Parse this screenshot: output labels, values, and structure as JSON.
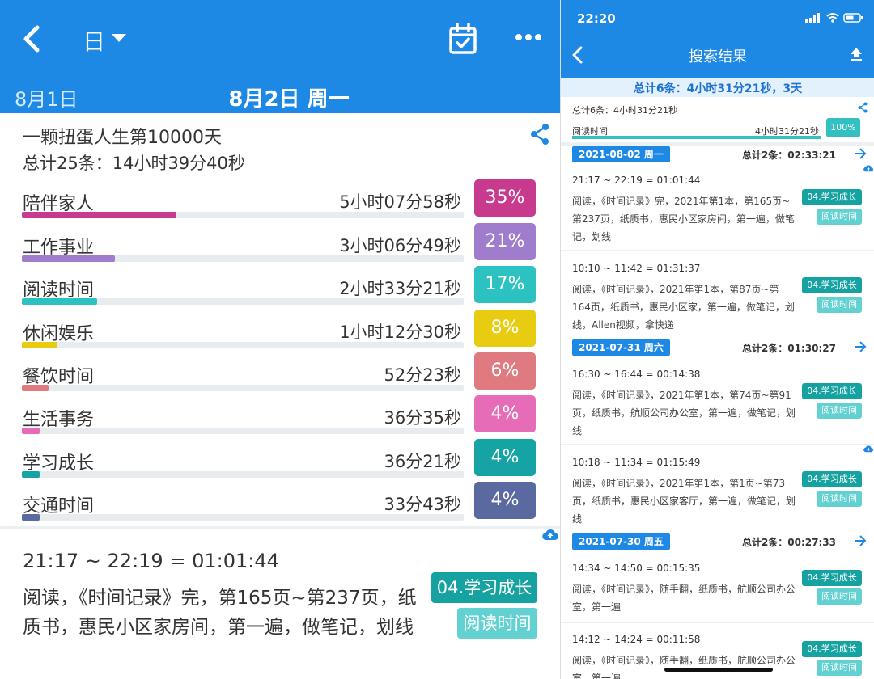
{
  "left": {
    "header": {
      "view_mode": "日"
    },
    "date_bar": {
      "prev_date": "8月1日",
      "current_date": "8月2日 周一"
    },
    "summary": {
      "title": "一颗扭蛋人生第10000天",
      "total": "总计25条：14小时39分40秒"
    },
    "categories": [
      {
        "name": "陪伴家人",
        "time": "5小时07分58秒",
        "pct_label": "35%",
        "fraction": 0.35,
        "color": "#c83a8e"
      },
      {
        "name": "工作事业",
        "time": "3小时06分49秒",
        "pct_label": "21%",
        "fraction": 0.21,
        "color": "#a07ccc"
      },
      {
        "name": "阅读时间",
        "time": "2小时33分21秒",
        "pct_label": "17%",
        "fraction": 0.17,
        "color": "#2dc2c2"
      },
      {
        "name": "休闲娱乐",
        "time": "1小时12分30秒",
        "pct_label": "8%",
        "fraction": 0.08,
        "color": "#e8cc12"
      },
      {
        "name": "餐饮时间",
        "time": "52分23秒",
        "pct_label": "6%",
        "fraction": 0.06,
        "color": "#de7a80"
      },
      {
        "name": "生活事务",
        "time": "36分35秒",
        "pct_label": "4%",
        "fraction": 0.04,
        "color": "#e76cb8"
      },
      {
        "name": "学习成长",
        "time": "36分21秒",
        "pct_label": "4%",
        "fraction": 0.04,
        "color": "#16a3a3"
      },
      {
        "name": "交通时间",
        "time": "33分43秒",
        "pct_label": "4%",
        "fraction": 0.04,
        "color": "#5a6aa0"
      }
    ],
    "entry": {
      "time": "21:17 ~ 22:19 = 01:01:44",
      "desc": "阅读，《时间记录》完，第165页~第237页，纸质书，惠民小区家房间，第一遍，做笔记，划线",
      "tag1": "04.学习成长",
      "tag2": "阅读时间"
    }
  },
  "right": {
    "status": {
      "clock": "22:20"
    },
    "header": {
      "title": "搜索结果"
    },
    "summary": "总计6条：4小时31分21秒，3天",
    "overview": {
      "total": "总计6条：4小时31分21秒",
      "category": "阅读时间",
      "time": "4小时31分21秒",
      "pct": "100%"
    },
    "days": [
      {
        "date": "2021-08-02 周一",
        "total": "总计2条：02:33:21",
        "entries": [
          {
            "time": "21:17 ~ 22:19 = 01:01:44",
            "desc": "阅读，《时间记录》完，2021年第1本，第165页~第237页，纸质书，惠民小区家房间，第一遍，做笔记，划线",
            "tag1": "04.学习成长",
            "tag2": "阅读时间"
          },
          {
            "time": "10:10 ~ 11:42 = 01:31:37",
            "desc": "阅读，《时间记录》，2021年第1本，第87页~第164页，纸质书，惠民小区家，第一遍，做笔记，划线，Allen视频，拿快递",
            "tag1": "04.学习成长",
            "tag2": "阅读时间"
          }
        ]
      },
      {
        "date": "2021-07-31 周六",
        "total": "总计2条：01:30:27",
        "entries": [
          {
            "time": "16:30 ~ 16:44 = 00:14:38",
            "desc": "阅读，《时间记录》，2021年第1本，第74页~第91页，纸质书，航顺公司办公室，第一遍，做笔记，划线",
            "tag1": "04.学习成长",
            "tag2": "阅读时间"
          },
          {
            "time": "10:18 ~ 11:34 = 01:15:49",
            "desc": "阅读，《时间记录》，2021年第1本，第1页~第73页，纸质书，惠民小区家客厅，第一遍，做笔记，划线",
            "tag1": "04.学习成长",
            "tag2": "阅读时间"
          }
        ]
      },
      {
        "date": "2021-07-30 周五",
        "total": "总计2条：00:27:33",
        "entries": [
          {
            "time": "14:34 ~ 14:50 = 00:15:35",
            "desc": "阅读，《时间记录》，随手翻，纸质书，航顺公司办公室，第一遍",
            "tag1": "04.学习成长",
            "tag2": "阅读时间"
          },
          {
            "time": "14:12 ~ 14:24 = 00:11:58",
            "desc": "阅读，《时间记录》，随手翻，纸质书，航顺公司办公室，第一遍",
            "tag1": "04.学习成长",
            "tag2": "阅读时间"
          }
        ]
      }
    ]
  }
}
